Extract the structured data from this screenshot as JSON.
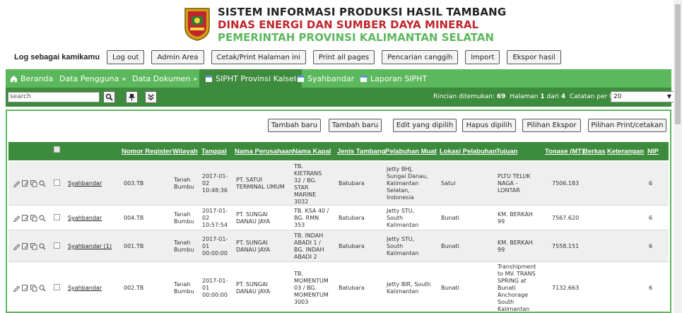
{
  "header": {
    "title1": "SISTEM INFORMASI PRODUKSI HASIL TAMBANG",
    "title2": "DINAS ENERGI DAN SUMBER DAYA MINERAL",
    "title3": "PEMERINTAH PROVINSI KALIMANTAN SELATAN"
  },
  "toolbar": {
    "login_label": "Log sebagai kamikamu",
    "buttons": [
      "Log out",
      "Admin Area",
      "Cetak/Print Halaman ini",
      "Print all pages",
      "Pencarian canggih",
      "Import",
      "Ekspor hasil"
    ]
  },
  "nav": {
    "items": [
      "Beranda",
      "Data Pengguna »",
      "Data Dokumen »",
      "SIPHT Provinsi Kalsel",
      "Syahbandar",
      "Laporan SIPHT"
    ]
  },
  "searchbar": {
    "placeholder": "search",
    "found_label": "Rincian ditemukan:",
    "found_count": "69",
    "page_label": "Halaman",
    "page_current": "1",
    "page_of": "dari",
    "page_total": "4",
    "per_page_label": "Catatan per halaman",
    "per_page_value": "20"
  },
  "actions": [
    "Tambah baru",
    "Tambah baru",
    "Edit yang dipilih",
    "Hapus dipilih",
    "Pilihan Ekspor",
    "Pilihan Print/cetakan"
  ],
  "table": {
    "headers": [
      "Nomor Register",
      "Wilayah",
      "Tanggal",
      "Nama Perusahaan",
      "Nama Kapal",
      "Jenis Tambang",
      "Pelabuhan Muat",
      "Lokasi Pelabuhan",
      "Tujuan",
      "Tonase (MT)",
      "Berkas",
      "Keterangan",
      "NIP"
    ],
    "rows": [
      {
        "link": "Syahbandar",
        "register": "003.TB",
        "wilayah": [
          "Tanah",
          "Bumbu"
        ],
        "tanggal": [
          "2017-01-",
          "02",
          "10:48:36"
        ],
        "perusahaan": [
          "PT. SATUI",
          "TERMINAL UMUM"
        ],
        "kapal": [
          "TB.",
          "KIETRANS",
          "32 / BG.",
          "STAR",
          "MARINE",
          "3032"
        ],
        "jenis": "Batubara",
        "pelabuhan": [
          "Jetty BHJ,",
          "Sungai Danau,",
          "Kalimantan",
          "Selatan,",
          "Indonesia"
        ],
        "lokasi": "Satui",
        "tujuan": [
          "PLTU TELUK",
          "NAGA -",
          "LONTAR"
        ],
        "tonase": "7506.183",
        "nip": "6"
      },
      {
        "link": "Syahbandar",
        "register": "004.TB",
        "wilayah": [
          "Tanah",
          "Bumbu"
        ],
        "tanggal": [
          "2017-01-",
          "02",
          "10:57:54"
        ],
        "perusahaan": [
          "PT. SUNGAI",
          "DANAU JAYA"
        ],
        "kapal": [
          "TB. KSA 40 /",
          "BG. RMN",
          "353"
        ],
        "jenis": "Batubara",
        "pelabuhan": [
          "Jetty STU,",
          "South",
          "Kalimantan"
        ],
        "lokasi": "Bunati",
        "tujuan": [
          "KM. BERKAH",
          "99"
        ],
        "tonase": "7567.620",
        "nip": "6"
      },
      {
        "link": "Syahbandar (1)",
        "register": "001.TB",
        "wilayah": [
          "Tanah",
          "Bumbu"
        ],
        "tanggal": [
          "2017-01-",
          "01",
          "00:00:00"
        ],
        "perusahaan": [
          "PT. SUNGAI",
          "DANAU JAYA"
        ],
        "kapal": [
          "TB. INDAH",
          "ABADI 1 /",
          "BG. INDAH",
          "ABADI 2"
        ],
        "jenis": "Batubara",
        "pelabuhan": [
          "Jetty STU,",
          "South",
          "Kalimantan"
        ],
        "lokasi": "Bunati",
        "tujuan": [
          "KM. BERKAH",
          "99"
        ],
        "tonase": "7558.151",
        "nip": "6"
      },
      {
        "link": "Syahbandar",
        "register": "002.TB",
        "wilayah": [
          "Tanah",
          "Bumbu"
        ],
        "tanggal": [
          "2017-01-",
          "01",
          "00:00:00"
        ],
        "perusahaan": [
          "PT. SUNGAI",
          "DANAU JAYA"
        ],
        "kapal": [
          "TB.",
          "MOMENTUM",
          "03 / BG.",
          "MOMENTUM",
          "3003"
        ],
        "jenis": "Batubara",
        "pelabuhan": [
          "Jetty BIR, South",
          "Kalimantan"
        ],
        "lokasi": "Bunati",
        "tujuan": [
          "Transhipment",
          "to MV. TRANS",
          "SPRING at",
          "Bunati",
          "Anchorage",
          "South",
          "Kalimantan"
        ],
        "tonase": "7132.663",
        "nip": "6"
      }
    ]
  },
  "colors": {
    "green": "#5cb85c",
    "dark_green": "#3d8b3d",
    "red": "#c0262d"
  }
}
